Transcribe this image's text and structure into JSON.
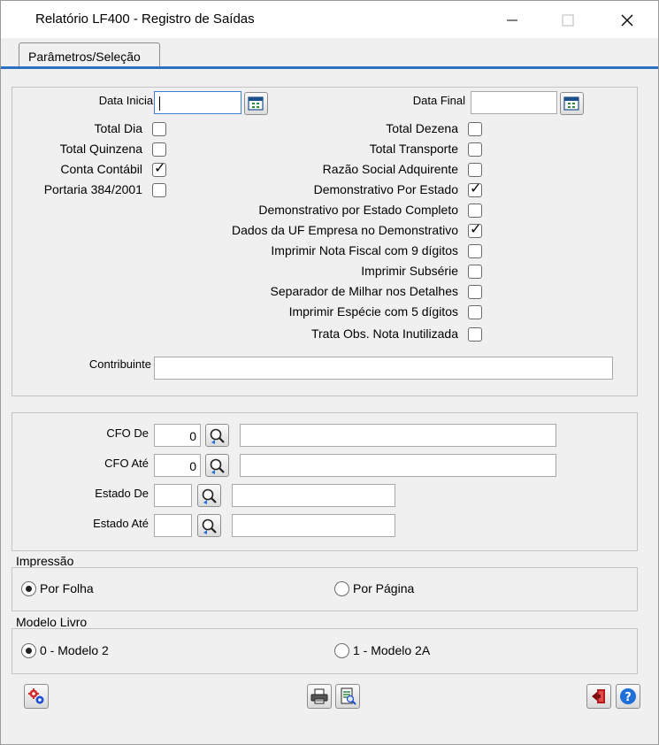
{
  "window": {
    "title": "Relatório LF400 - Registro de Saídas"
  },
  "tabs": [
    {
      "label": "Parâmetros/Seleção",
      "active": true
    }
  ],
  "params": {
    "data_inicial_label": "Data Inicial",
    "data_inicial_value": "",
    "data_final_label": "Data Final",
    "data_final_value": "",
    "contribuinte_label": "Contribuinte",
    "contribuinte_value": "",
    "left_checks": [
      {
        "label": "Total Dia",
        "checked": false
      },
      {
        "label": "Total Quinzena",
        "checked": false
      },
      {
        "label": "Conta Contábil",
        "checked": true
      },
      {
        "label": "Portaria 384/2001",
        "checked": false
      }
    ],
    "right_checks": [
      {
        "label": "Total Dezena",
        "checked": false
      },
      {
        "label": "Total Transporte",
        "checked": false
      },
      {
        "label": "Razão Social Adquirente",
        "checked": false
      },
      {
        "label": "Demonstrativo Por Estado",
        "checked": true
      },
      {
        "label": "Demonstrativo por Estado Completo",
        "checked": false
      },
      {
        "label": "Dados da UF Empresa no Demonstrativo",
        "checked": true
      },
      {
        "label": "Imprimir Nota Fiscal com 9 dígitos",
        "checked": false
      },
      {
        "label": "Imprimir Subsérie",
        "checked": false
      },
      {
        "label": "Separador de Milhar nos Detalhes",
        "checked": false
      },
      {
        "label": "Imprimir Espécie com 5 dígitos",
        "checked": false
      },
      {
        "label": "Trata Obs. Nota Inutilizada",
        "checked": false
      }
    ]
  },
  "ranges": {
    "cfo_de_label": "CFO De",
    "cfo_de_value": "0",
    "cfo_de_desc": "",
    "cfo_ate_label": "CFO Até",
    "cfo_ate_value": "0",
    "cfo_ate_desc": "",
    "estado_de_label": "Estado De",
    "estado_de_value": "",
    "estado_de_desc": "",
    "estado_ate_label": "Estado Até",
    "estado_ate_value": "",
    "estado_ate_desc": ""
  },
  "impressao": {
    "title": "Impressão",
    "options": [
      {
        "label": "Por Folha",
        "selected": true
      },
      {
        "label": "Por Página",
        "selected": false
      }
    ]
  },
  "modelo": {
    "title": "Modelo Livro",
    "options": [
      {
        "label": "0 - Modelo 2",
        "selected": true
      },
      {
        "label": "1 - Modelo 2A",
        "selected": false
      }
    ]
  },
  "checkmark": "✓",
  "icons": {
    "minimize": "minimize-icon",
    "maximize": "maximize-icon",
    "close": "close-icon",
    "calendar": "calendar-icon",
    "search": "magnifier-icon",
    "settings": "gears-icon",
    "print": "printer-icon",
    "preview": "print-preview-icon",
    "exit": "exit-icon",
    "help": "help-icon"
  },
  "colors": {
    "accent": "#2f6fc0",
    "focus_border": "#3c7fd6",
    "help_blue": "#1f6fd8",
    "exit_red": "#b31b1b"
  }
}
